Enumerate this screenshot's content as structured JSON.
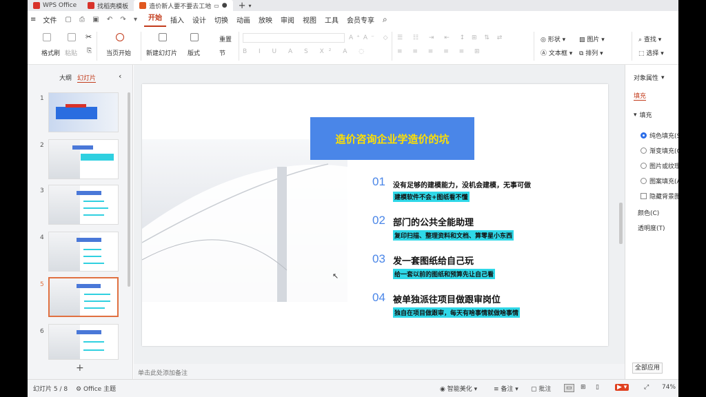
{
  "tabs": [
    {
      "label": "WPS Office",
      "color": "#d8322a"
    },
    {
      "label": "找稻壳模板",
      "color": "#d8322a"
    },
    {
      "label": "造价新人要不要去工地",
      "color": "#e0581f"
    }
  ],
  "menu": [
    "文件",
    "开始",
    "插入",
    "设计",
    "切换",
    "动画",
    "放映",
    "审阅",
    "视图",
    "工具",
    "会员专享"
  ],
  "menu_active": "开始",
  "ribbon": {
    "format_painter": "格式刷",
    "paste": "粘贴",
    "play_from_current": "当页开始",
    "new_slide": "新建幻灯片",
    "layout": "版式",
    "reset": "重置",
    "section": "节",
    "shape": "形状",
    "picture": "图片",
    "find": "查找",
    "textbox": "文本框",
    "arrange": "排列",
    "select": "选择"
  },
  "left_panel": {
    "outline": "大纲",
    "slides": "幻灯片",
    "add": "+"
  },
  "slide_numbers": [
    "1",
    "2",
    "3",
    "4",
    "5",
    "6"
  ],
  "slide": {
    "title": "造价咨询企业学造价的坑",
    "items": [
      {
        "num": "01",
        "heading": "没有足够的建模能力，没机会建模，无事可做",
        "sub": "建模软件不会+图纸看不懂"
      },
      {
        "num": "02",
        "heading": "部门的公共全能助理",
        "sub": "复印扫描、整理资料和文档、算零星小东西"
      },
      {
        "num": "03",
        "heading": "发一套图纸给自己玩",
        "sub": "给一套以前的图纸和预算先让自己看"
      },
      {
        "num": "04",
        "heading": "被单独派往项目做跟审岗位",
        "sub": "独自在项目做跟审，每天有啥事情就做啥事情"
      }
    ],
    "title_color": "#ffe000",
    "title_bg": "#4a86e8",
    "highlight": "#2fd8e8"
  },
  "notes_placeholder": "单击此处添加备注",
  "right_panel": {
    "title": "对象属性",
    "fill_tab": "填充",
    "fill_section": "填充",
    "options": [
      "纯色填充(S)",
      "渐变填充(G)",
      "图片或纹理",
      "图案填充(A)"
    ],
    "hide_bg": "隐藏背景图",
    "color_label": "颜色(C)",
    "transparency_label": "透明度(T)",
    "apply_all": "全部应用"
  },
  "status": {
    "slide_pos": "幻灯片 5 / 8",
    "theme": "Office 主题",
    "smart": "智能美化",
    "notes": "备注",
    "comments": "批注",
    "zoom": "74%"
  }
}
